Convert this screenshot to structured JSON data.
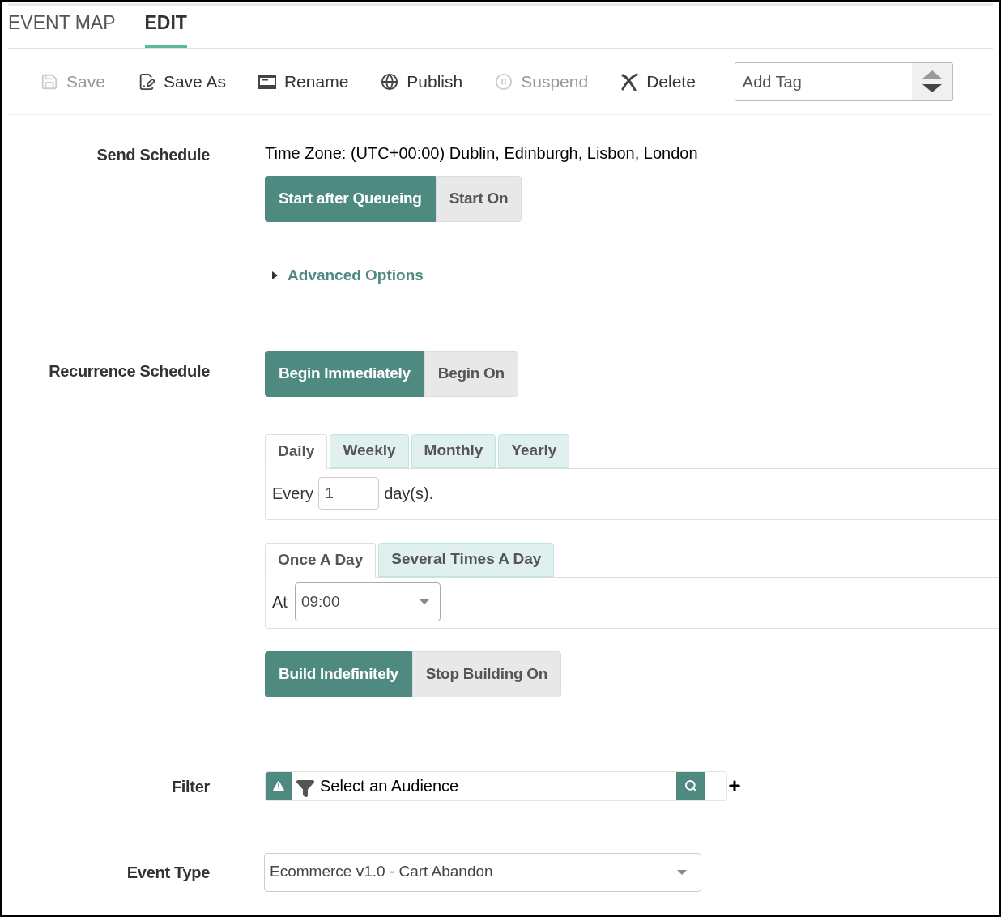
{
  "tabs": [
    {
      "label": "EVENT MAP",
      "selected": false
    },
    {
      "label": "EDIT",
      "selected": true
    }
  ],
  "toolbar": [
    {
      "kind": "save",
      "label": "Save",
      "disabled": true
    },
    {
      "kind": "save-as",
      "label": "Save As",
      "disabled": false
    },
    {
      "kind": "rename",
      "label": "Rename",
      "disabled": false
    },
    {
      "kind": "publish",
      "label": "Publish",
      "disabled": false
    },
    {
      "kind": "suspend",
      "label": "Suspend",
      "disabled": true
    },
    {
      "kind": "delete",
      "label": "Delete",
      "disabled": false
    }
  ],
  "tag_field": {
    "placeholder": "Add Tag"
  },
  "send_schedule": {
    "label": "Send Schedule",
    "time_zone": "Time Zone: (UTC+00:00) Dublin, Edinburgh, Lisbon, London",
    "options": [
      {
        "label": "Start after Queueing",
        "selected": true
      },
      {
        "label": "Start On",
        "selected": false
      }
    ],
    "advanced_options": {
      "label": "Advanced Options",
      "expanded": false
    }
  },
  "recurrence_schedule": {
    "label": "Recurrence Schedule",
    "begin_options": [
      {
        "label": "Begin Immediately",
        "selected": true
      },
      {
        "label": "Begin On",
        "selected": false
      }
    ],
    "frequency_tabs": [
      {
        "label": "Daily",
        "selected": true
      },
      {
        "label": "Weekly",
        "selected": false
      },
      {
        "label": "Monthly",
        "selected": false
      },
      {
        "label": "Yearly",
        "selected": false
      }
    ],
    "every_label": "Every",
    "every_value": "1",
    "every_unit": "day(s).",
    "time_tabs": [
      {
        "label": "Once A Day",
        "selected": true
      },
      {
        "label": "Several Times A Day",
        "selected": false
      }
    ],
    "at_label": "At",
    "at_value": "09:00",
    "build_options": [
      {
        "label": "Build Indefinitely",
        "selected": true
      },
      {
        "label": "Stop Building On",
        "selected": false
      }
    ]
  },
  "filter": {
    "label": "Filter",
    "placeholder": "Select an Audience"
  },
  "event_type": {
    "label": "Event Type",
    "value": "Ecommerce v1.0 - Cart Abandon"
  }
}
